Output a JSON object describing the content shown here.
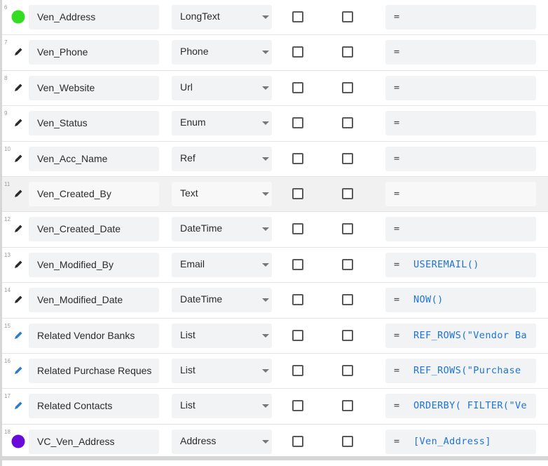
{
  "rows": [
    {
      "num": "6",
      "icon": "green-dot-icon",
      "name": "Ven_Address",
      "type": "LongText",
      "key": false,
      "label": false,
      "eq": "=",
      "formula": ""
    },
    {
      "num": "7",
      "icon": "pencil-icon",
      "name": "Ven_Phone",
      "type": "Phone",
      "key": false,
      "label": false,
      "eq": "=",
      "formula": ""
    },
    {
      "num": "8",
      "icon": "pencil-icon",
      "name": "Ven_Website",
      "type": "Url",
      "key": false,
      "label": false,
      "eq": "=",
      "formula": ""
    },
    {
      "num": "9",
      "icon": "pencil-icon",
      "name": "Ven_Status",
      "type": "Enum",
      "key": false,
      "label": false,
      "eq": "=",
      "formula": ""
    },
    {
      "num": "10",
      "icon": "pencil-icon",
      "name": "Ven_Acc_Name",
      "type": "Ref",
      "key": false,
      "label": false,
      "eq": "=",
      "formula": ""
    },
    {
      "num": "11",
      "icon": "pencil-icon",
      "name": "Ven_Created_By",
      "type": "Text",
      "key": false,
      "label": false,
      "eq": "=",
      "formula": "",
      "highlighted": true
    },
    {
      "num": "12",
      "icon": "pencil-icon",
      "name": "Ven_Created_Date",
      "type": "DateTime",
      "key": false,
      "label": false,
      "eq": "=",
      "formula": ""
    },
    {
      "num": "13",
      "icon": "pencil-icon",
      "name": "Ven_Modified_By",
      "type": "Email",
      "key": false,
      "label": false,
      "eq": "=",
      "formula": "USEREMAIL()"
    },
    {
      "num": "14",
      "icon": "pencil-icon",
      "name": "Ven_Modified_Date",
      "type": "DateTime",
      "key": false,
      "label": false,
      "eq": "=",
      "formula": "NOW()"
    },
    {
      "num": "15",
      "icon": "blue-pencil-icon",
      "name": "Related Vendor Banks",
      "type": "List",
      "key": false,
      "label": false,
      "eq": "=",
      "formula": "REF_ROWS(\"Vendor Ba"
    },
    {
      "num": "16",
      "icon": "blue-pencil-icon",
      "name": "Related Purchase Reques",
      "type": "List",
      "key": false,
      "label": false,
      "eq": "=",
      "formula": "REF_ROWS(\"Purchase"
    },
    {
      "num": "17",
      "icon": "blue-pencil-icon",
      "name": "Related Contacts",
      "type": "List",
      "key": false,
      "label": false,
      "eq": "=",
      "formula": "ORDERBY( FILTER(\"Ve"
    },
    {
      "num": "18",
      "icon": "purple-dot-icon",
      "name": "VC_Ven_Address",
      "type": "Address",
      "key": false,
      "label": false,
      "eq": "=",
      "formula": "[Ven_Address]"
    }
  ],
  "colors": {
    "green_dot": "#33dd22",
    "purple_dot": "#6a0ad8",
    "pencil_dark": "#2b2b2b",
    "pencil_blue": "#2a7bd6",
    "formula_text": "#1e73d8"
  }
}
